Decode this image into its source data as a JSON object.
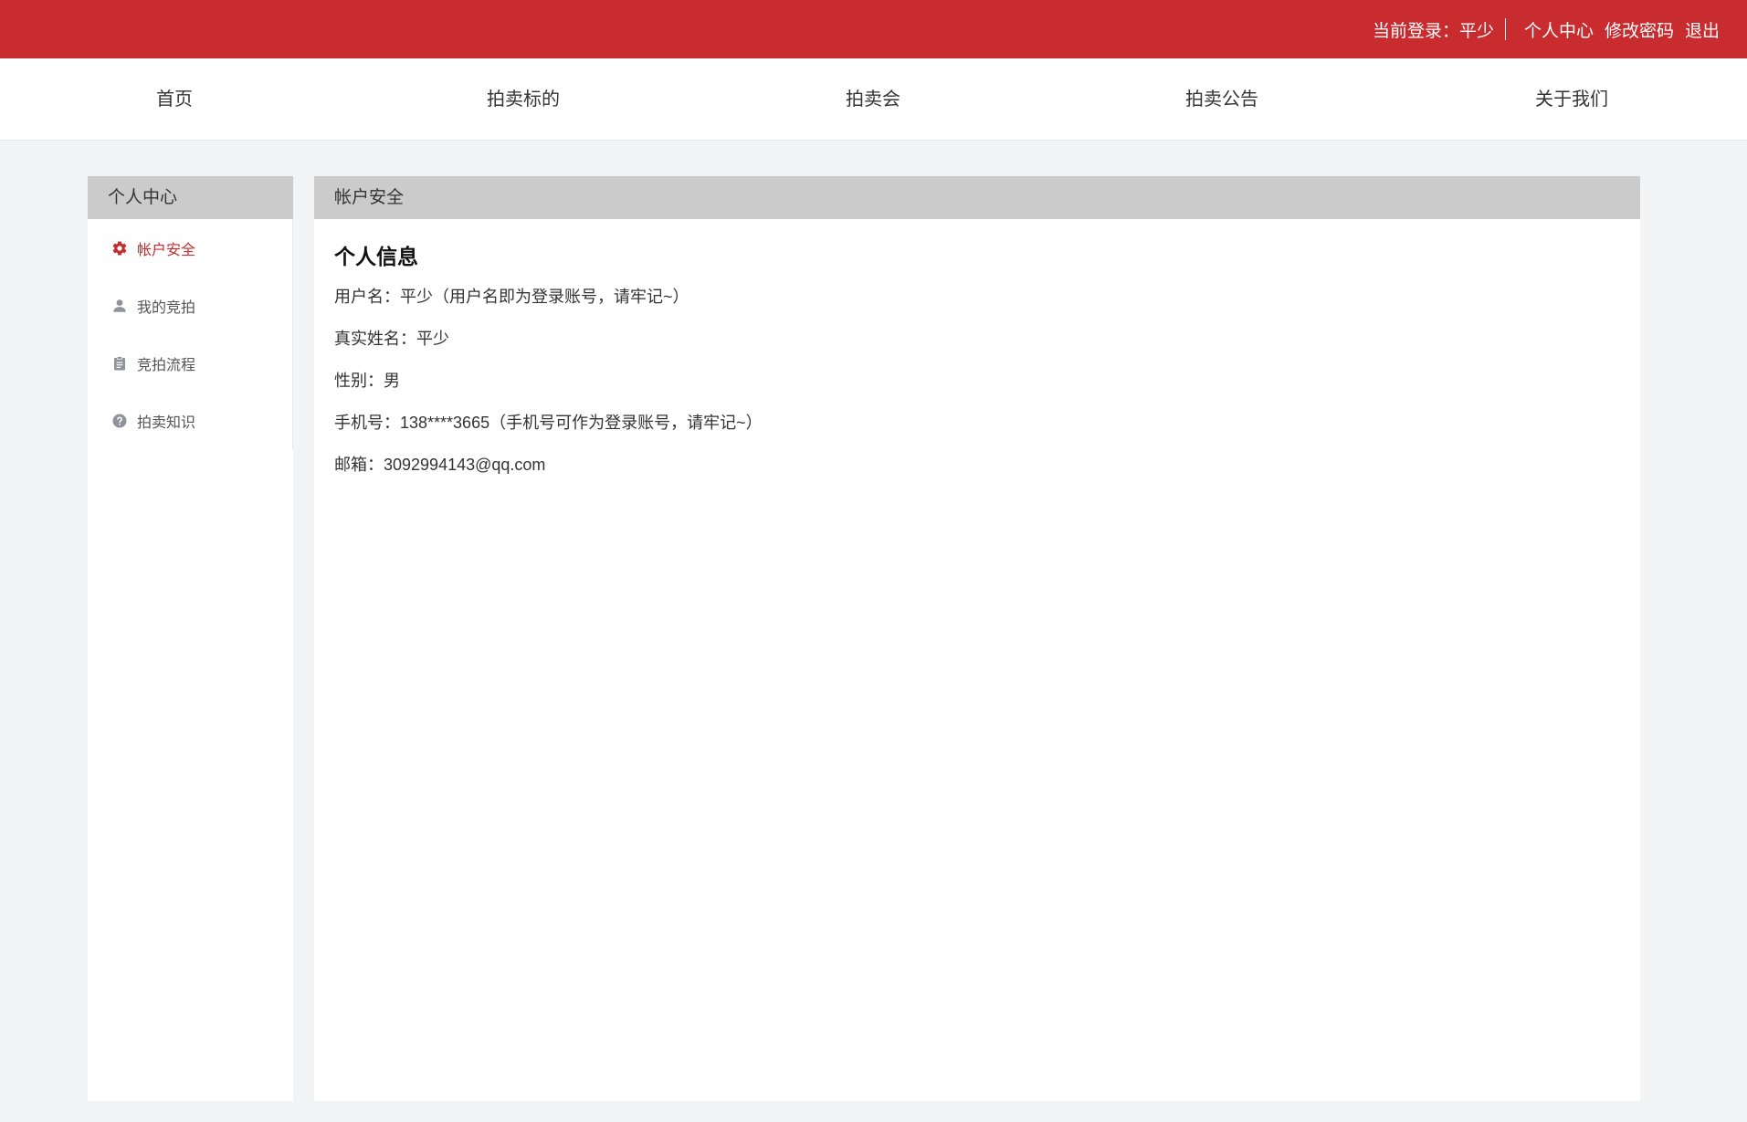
{
  "topbar": {
    "current_login_label": "当前登录：平少",
    "links": [
      "个人中心",
      "修改密码",
      "退出"
    ]
  },
  "nav": {
    "items": [
      "首页",
      "拍卖标的",
      "拍卖会",
      "拍卖公告",
      "关于我们"
    ]
  },
  "sidebar": {
    "title": "个人中心",
    "items": [
      {
        "label": "帐户安全",
        "icon": "gear-icon",
        "active": true
      },
      {
        "label": "我的竞拍",
        "icon": "user-icon",
        "active": false
      },
      {
        "label": "竞拍流程",
        "icon": "clipboard-icon",
        "active": false
      },
      {
        "label": "拍卖知识",
        "icon": "question-icon",
        "active": false
      }
    ]
  },
  "main": {
    "header": "帐户安全",
    "section_title": "个人信息",
    "rows": [
      "用户名：平少（用户名即为登录账号，请牢记~）",
      "真实姓名：平少",
      "性别：男",
      "手机号：138****3665（手机号可作为登录账号，请牢记~）",
      "邮箱：3092994143@qq.com"
    ]
  },
  "colors": {
    "brand_red": "#c82c2f",
    "panel_header_gray": "#cbcbcb",
    "page_bg": "#f3f4f6",
    "icon_gray": "#8f9399"
  }
}
